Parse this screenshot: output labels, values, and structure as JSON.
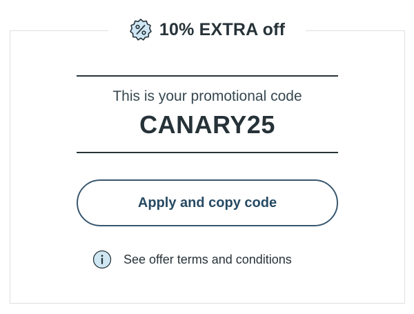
{
  "header": {
    "icon": "percent-badge-icon",
    "title": "10% EXTRA off"
  },
  "promo": {
    "caption": "This is your promotional code",
    "code": "CANARY25"
  },
  "apply_button": {
    "label": "Apply and copy code"
  },
  "terms": {
    "icon": "info-icon",
    "label": "See offer terms and conditions"
  },
  "colors": {
    "text": "#263238",
    "button_border": "#37566e",
    "button_text": "#264a63",
    "icon_fill": "#cfe6f3",
    "card_border": "#dcdfe2"
  }
}
